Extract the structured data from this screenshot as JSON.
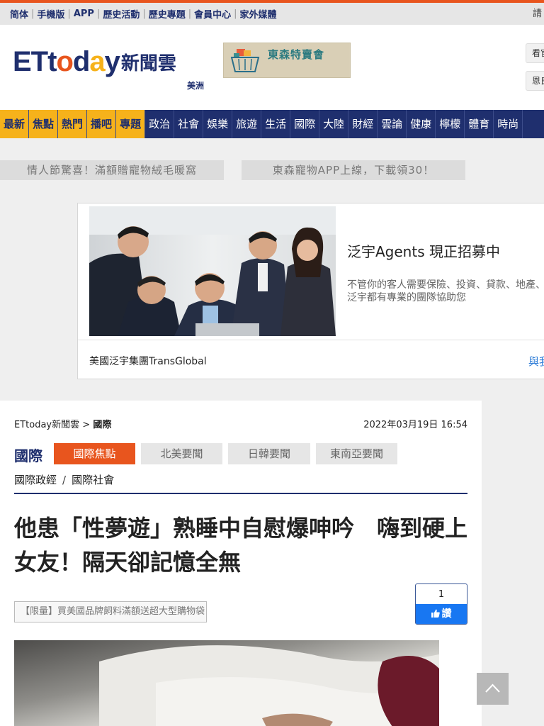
{
  "topbar": {
    "links": [
      "简体",
      "手機版",
      "APP",
      "歷史活動",
      "歷史專題",
      "會員中心",
      "家外媒體"
    ],
    "right_text": "請"
  },
  "header": {
    "logo_latin": "ETtoday",
    "logo_cn": "新聞雲",
    "region": "美洲",
    "banner_text": "東森特賣會",
    "side_buttons": [
      "看官",
      "恩良"
    ]
  },
  "nav": {
    "highlight": [
      "最新",
      "焦點",
      "熱門",
      "播吧",
      "專題"
    ],
    "items": [
      "政治",
      "社會",
      "娛樂",
      "旅遊",
      "生活",
      "國際",
      "大陸",
      "財經",
      "雲論",
      "健康",
      "檸檬",
      "體育",
      "時尚"
    ]
  },
  "promos": [
    "情人節驚喜！滿額贈寵物絨毛暖窩",
    "東森寵物APP上線，下載領30！"
  ],
  "ad": {
    "title": "泛宇Agents 現正招募中",
    "desc_line1": "不管你的客人需要保險、投資、貸款、地產、",
    "desc_line2": "泛宇都有專業的團隊協助您",
    "company": "美國泛宇集團TransGlobal",
    "cta": "與我"
  },
  "article": {
    "breadcrumb_home": "ETtoday新聞雲",
    "breadcrumb_sep": ">",
    "breadcrumb_current": "國際",
    "date": "2022年03月19日 16:54",
    "section": "國際",
    "subtabs": [
      "國際焦點",
      "北美要聞",
      "日韓要聞",
      "東南亞要聞"
    ],
    "tags": [
      "國際政經",
      "國際社會"
    ],
    "tag_sep": "/",
    "headline": "他患「性夢遊」熟睡中自慰爆呻吟　嗨到硬上女友！隔天卻記憶全無",
    "promo_link": "【限量】買美國品牌飼料滿額送超大型購物袋",
    "like_count": "1",
    "like_label": "讚"
  }
}
